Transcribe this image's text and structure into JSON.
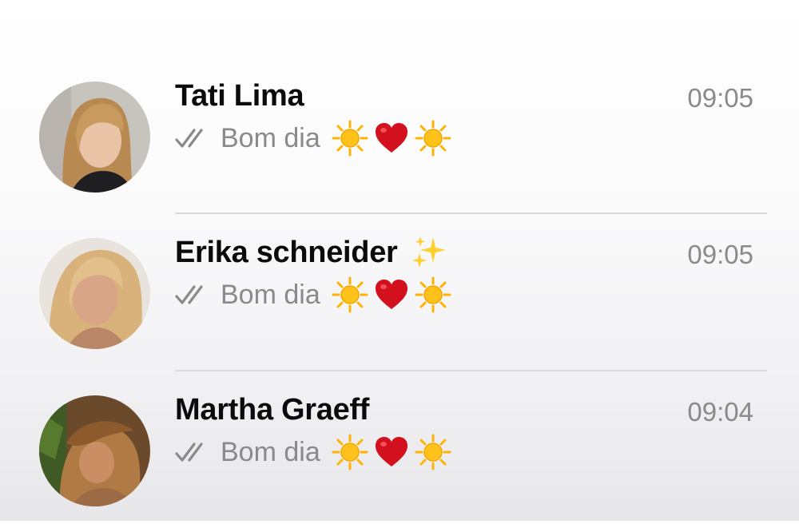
{
  "chats": [
    {
      "name": "Tati Lima",
      "name_emoji": null,
      "time": "09:05",
      "preview": "Bom dia",
      "preview_emojis": [
        "sun-emoji",
        "heart-emoji",
        "sun-emoji"
      ],
      "status_icon": "double-check-icon"
    },
    {
      "name": "Erika schneider",
      "name_emoji": "sparkles-emoji",
      "time": "09:05",
      "preview": "Bom dia",
      "preview_emojis": [
        "sun-emoji",
        "heart-emoji",
        "sun-emoji"
      ],
      "status_icon": "double-check-icon"
    },
    {
      "name": "Martha Graeff",
      "name_emoji": null,
      "time": "09:04",
      "preview": "Bom dia",
      "preview_emojis": [
        "sun-emoji",
        "heart-emoji",
        "sun-emoji"
      ],
      "status_icon": "double-check-icon"
    }
  ],
  "colors": {
    "name": "#0b0b0b",
    "time": "#8a8a8e",
    "preview": "#8a8a8e",
    "ticks": "#8a8a8e",
    "heart": "#d2101e",
    "sun": "#ffc21a",
    "separator": "#d9d9dc"
  }
}
